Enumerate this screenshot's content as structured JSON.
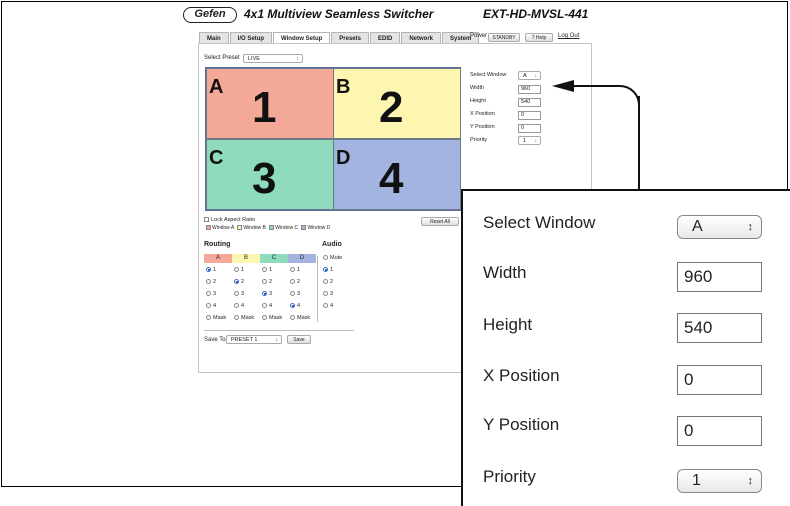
{
  "header": {
    "logo": "Gefen",
    "title": "4x1 Multiview Seamless Switcher",
    "model": "EXT-HD-MVSL-441"
  },
  "tabs": [
    {
      "label": "Main"
    },
    {
      "label": "I/O Setup"
    },
    {
      "label": "Window Setup",
      "active": true
    },
    {
      "label": "Presets"
    },
    {
      "label": "EDID"
    },
    {
      "label": "Network"
    },
    {
      "label": "System"
    }
  ],
  "topbar": {
    "power_label": "Power",
    "standby_label": "STANDBY",
    "help_label": "? Help",
    "logout_label": "Log Out"
  },
  "preset": {
    "label": "Select Preset",
    "value": "LIVE"
  },
  "windows": [
    {
      "letter": "A",
      "number": "1",
      "color": "#f4a898"
    },
    {
      "letter": "B",
      "number": "2",
      "color": "#fcf6b0"
    },
    {
      "letter": "C",
      "number": "3",
      "color": "#8fdcbc"
    },
    {
      "letter": "D",
      "number": "4",
      "color": "#a4b4e0"
    }
  ],
  "window_settings": {
    "select_window_label": "Select Window",
    "select_window_value": "A",
    "width_label": "Width",
    "width_value": "960",
    "height_label": "Height",
    "height_value": "540",
    "xpos_label": "X Position",
    "xpos_value": "0",
    "ypos_label": "Y Position",
    "ypos_value": "0",
    "priority_label": "Priority",
    "priority_value": "1"
  },
  "options": {
    "lock_aspect": "Lock Aspect Ratio",
    "legend": [
      "Window A",
      "Window B",
      "Window C",
      "Window D"
    ],
    "reset_all": "Reset All"
  },
  "routing": {
    "title": "Routing",
    "columns": [
      "A",
      "B",
      "C",
      "D"
    ],
    "rows": [
      "1",
      "2",
      "3",
      "4",
      "Mask"
    ],
    "selected": [
      "1",
      "2",
      "3",
      "4"
    ]
  },
  "audio": {
    "title": "Audio",
    "options": [
      "Mute",
      "1",
      "2",
      "3",
      "4"
    ],
    "selected": "1"
  },
  "save": {
    "label": "Save To",
    "value": "PRESET 1",
    "button": "Save"
  }
}
